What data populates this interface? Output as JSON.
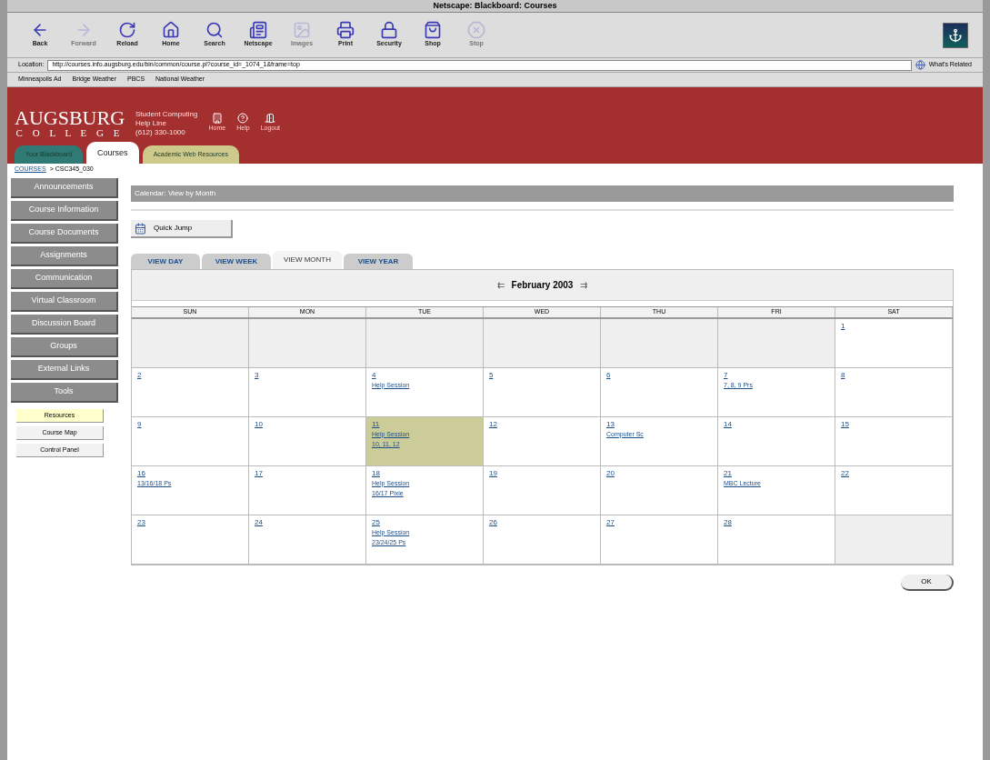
{
  "window": {
    "title": "Netscape: Blackboard: Courses"
  },
  "toolbar": [
    {
      "label": "Back",
      "disabled": false
    },
    {
      "label": "Forward",
      "disabled": true
    },
    {
      "label": "Reload",
      "disabled": false
    },
    {
      "label": "Home",
      "disabled": false
    },
    {
      "label": "Search",
      "disabled": false
    },
    {
      "label": "Netscape",
      "disabled": false
    },
    {
      "label": "Images",
      "disabled": true
    },
    {
      "label": "Print",
      "disabled": false
    },
    {
      "label": "Security",
      "disabled": false
    },
    {
      "label": "Shop",
      "disabled": false
    },
    {
      "label": "Stop",
      "disabled": true
    }
  ],
  "location": {
    "label": "Location:",
    "value": "http://courses.info.augsburg.edu/bin/common/course.pl?course_id=_1074_1&frame=top",
    "related": "What's Related"
  },
  "bookmarks": [
    "Minneapolis Ad",
    "Bridge Weather",
    "PBCS",
    "National Weather"
  ],
  "header": {
    "logo_top": "AUGSBURG",
    "logo_bottom": "C O L L E G E",
    "contact": [
      "Student Computing",
      "Help Line",
      "(612) 330-1000"
    ],
    "links": [
      "Home",
      "Help",
      "Logout"
    ]
  },
  "tabs": [
    {
      "label": "Your Blackboard",
      "color": "#2f7a74",
      "selected": false
    },
    {
      "label": "Courses",
      "color": "#ffffff",
      "selected": true
    },
    {
      "label": "Academic Web Resources",
      "color": "#cdc98a",
      "selected": false
    }
  ],
  "breadcrumb": {
    "link": "COURSES",
    "current": "> CSC345_030"
  },
  "sidebar": [
    {
      "label": "Announcements"
    },
    {
      "label": "Course Information"
    },
    {
      "label": "Course Documents"
    },
    {
      "label": "Assignments"
    },
    {
      "label": "Communication"
    },
    {
      "label": "Virtual Classroom"
    },
    {
      "label": "Discussion Board"
    },
    {
      "label": "Groups"
    },
    {
      "label": "External Links"
    },
    {
      "label": "Tools"
    }
  ],
  "tools": [
    {
      "label": "Resources",
      "selected": true
    },
    {
      "label": "Course Map",
      "selected": false
    },
    {
      "label": "Control Panel",
      "selected": false
    }
  ],
  "page_title": "Calendar: View by Month",
  "quick_jump": "Quick Jump",
  "view_tabs": [
    {
      "label": "VIEW DAY",
      "selected": false
    },
    {
      "label": "VIEW WEEK",
      "selected": false
    },
    {
      "label": "VIEW MONTH",
      "selected": true
    },
    {
      "label": "VIEW YEAR",
      "selected": false
    }
  ],
  "month": {
    "prev": "⇇",
    "label": "February 2003",
    "next": "⇉"
  },
  "weekdays": [
    "SUN",
    "MON",
    "TUE",
    "WED",
    "THU",
    "FRI",
    "SAT"
  ],
  "weeks": [
    [
      {
        "kind": "blank",
        "selected": false
      },
      {
        "kind": "blank",
        "selected": false
      },
      {
        "kind": "blank",
        "selected": false
      },
      {
        "kind": "blank",
        "selected": false
      },
      {
        "kind": "blank",
        "selected": false
      },
      {
        "kind": "blank",
        "selected": false
      },
      {
        "kind": "day",
        "day": "1",
        "selected": false
      }
    ],
    [
      {
        "kind": "day",
        "day": "2",
        "selected": false
      },
      {
        "kind": "day",
        "day": "3",
        "selected": false
      },
      {
        "kind": "day",
        "day": "4",
        "events": [
          "Help Session"
        ],
        "selected": false
      },
      {
        "kind": "day",
        "day": "5",
        "selected": false
      },
      {
        "kind": "day",
        "day": "6",
        "selected": false
      },
      {
        "kind": "day",
        "day": "7",
        "events": [
          "7, 8, 9 Prs"
        ],
        "selected": false
      },
      {
        "kind": "day",
        "day": "8",
        "selected": false
      }
    ],
    [
      {
        "kind": "day",
        "day": "9",
        "selected": false
      },
      {
        "kind": "day",
        "day": "10",
        "selected": false
      },
      {
        "kind": "day",
        "day": "11",
        "events": [
          "Help Session",
          "10, 11, 12"
        ],
        "selected": true
      },
      {
        "kind": "day",
        "day": "12",
        "selected": false
      },
      {
        "kind": "day",
        "day": "13",
        "events": [
          "Computer Sc"
        ],
        "selected": false
      },
      {
        "kind": "day",
        "day": "14",
        "selected": false
      },
      {
        "kind": "day",
        "day": "15",
        "selected": false
      }
    ],
    [
      {
        "kind": "day",
        "day": "16",
        "events": [
          "13/16/18 Ps"
        ],
        "selected": false
      },
      {
        "kind": "day",
        "day": "17",
        "selected": false
      },
      {
        "kind": "day",
        "day": "18",
        "events": [
          "Help Session",
          "16/17 Pixie"
        ],
        "selected": false
      },
      {
        "kind": "day",
        "day": "19",
        "selected": false
      },
      {
        "kind": "day",
        "day": "20",
        "selected": false
      },
      {
        "kind": "day",
        "day": "21",
        "events": [
          "MBC Lecture"
        ],
        "selected": false
      },
      {
        "kind": "day",
        "day": "22",
        "selected": false
      }
    ],
    [
      {
        "kind": "day",
        "day": "23",
        "selected": false
      },
      {
        "kind": "day",
        "day": "24",
        "selected": false
      },
      {
        "kind": "day",
        "day": "25",
        "events": [
          "Help Session",
          "23/24/25 Ps"
        ],
        "selected": false
      },
      {
        "kind": "day",
        "day": "26",
        "selected": false
      },
      {
        "kind": "day",
        "day": "27",
        "selected": false
      },
      {
        "kind": "day",
        "day": "28",
        "selected": false
      },
      {
        "kind": "blank",
        "selected": false
      }
    ]
  ],
  "ok_button": "OK"
}
